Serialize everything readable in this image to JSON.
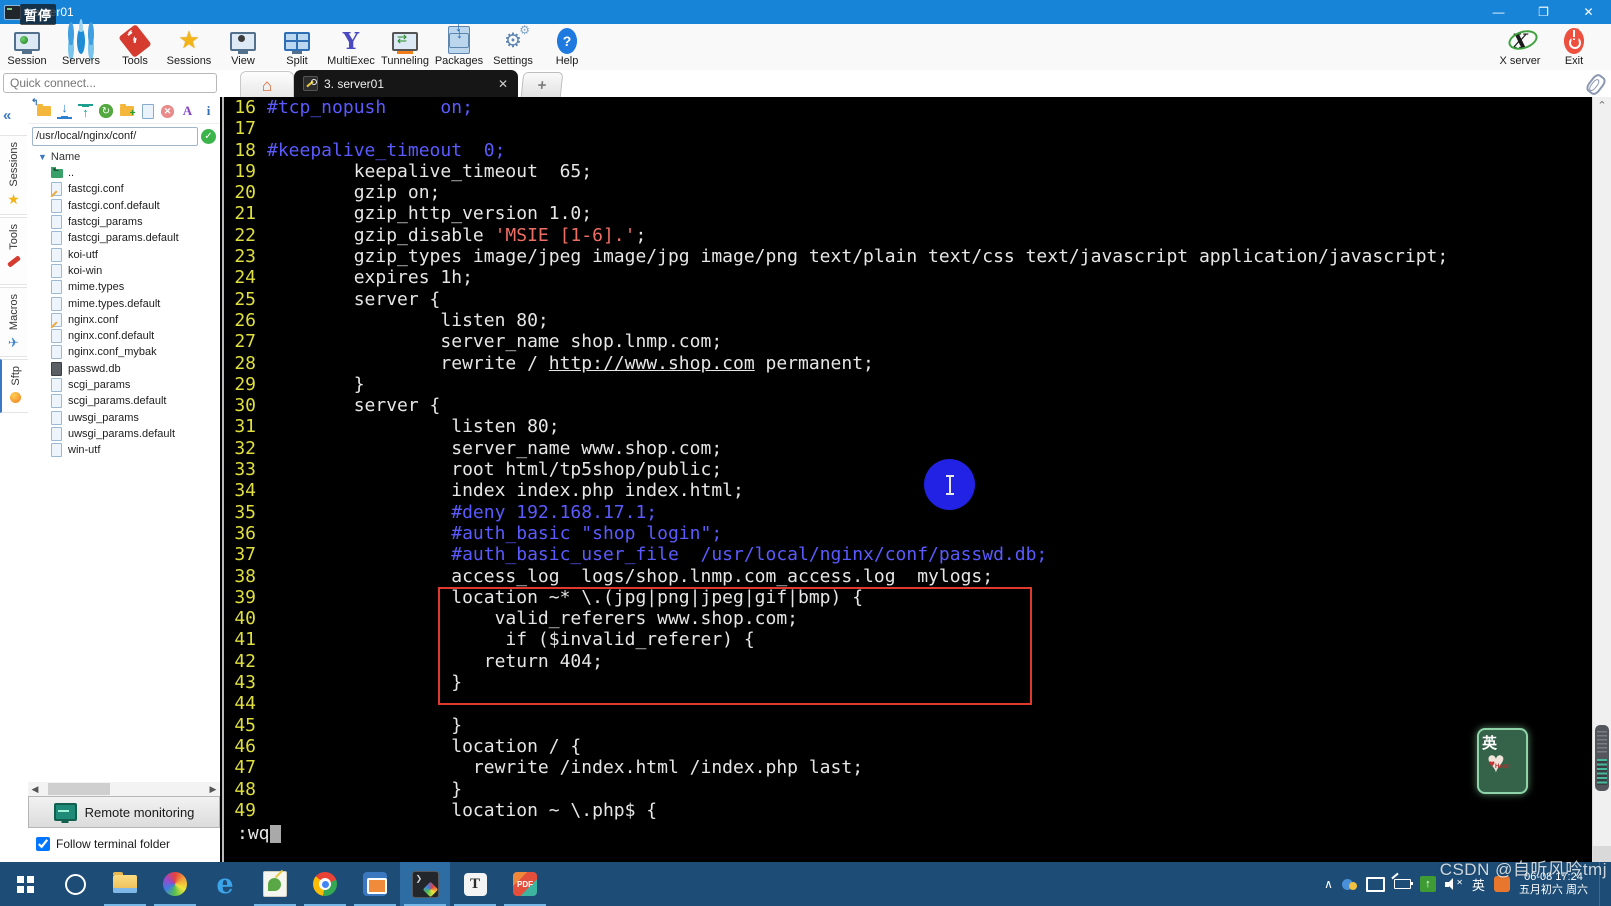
{
  "window": {
    "title": "server01",
    "recorder_overlay": "暂停",
    "controls": {
      "minimize": "—",
      "maximize": "❐",
      "close": "✕"
    }
  },
  "toolbar": {
    "items": [
      {
        "name": "session",
        "label": "Session"
      },
      {
        "name": "servers",
        "label": "Servers"
      },
      {
        "name": "tools",
        "label": "Tools"
      },
      {
        "name": "sessions",
        "label": "Sessions"
      },
      {
        "name": "view",
        "label": "View"
      },
      {
        "name": "split",
        "label": "Split"
      },
      {
        "name": "multiexec",
        "label": "MultiExec"
      },
      {
        "name": "tunneling",
        "label": "Tunneling"
      },
      {
        "name": "packages",
        "label": "Packages"
      },
      {
        "name": "settings",
        "label": "Settings"
      },
      {
        "name": "help",
        "label": "Help"
      }
    ],
    "right_items": [
      {
        "name": "xserver",
        "label": "X server"
      },
      {
        "name": "exit",
        "label": "Exit"
      }
    ]
  },
  "tabbar": {
    "quick_connect_placeholder": "Quick connect...",
    "active_tab": "3. server01",
    "close_glyph": "✕",
    "new_tab_glyph": "+"
  },
  "sidebar": {
    "tabs": [
      {
        "name": "sessions",
        "label": "Sessions",
        "icon": "star"
      },
      {
        "name": "tools",
        "label": "Tools",
        "icon": "knife"
      },
      {
        "name": "macros",
        "label": "Macros",
        "icon": "plane"
      },
      {
        "name": "sftp",
        "label": "Sftp",
        "icon": "ball",
        "active": true
      }
    ],
    "file_toolbar": [
      "parent-dir",
      "download",
      "upload",
      "refresh",
      "new-folder",
      "new-file",
      "delete",
      "rename",
      "info"
    ],
    "path": "/usr/local/nginx/conf/",
    "column_header": "Name",
    "files": [
      {
        "name": "..",
        "type": "parent"
      },
      {
        "name": "fastcgi.conf",
        "type": "edited"
      },
      {
        "name": "fastcgi.conf.default",
        "type": "file"
      },
      {
        "name": "fastcgi_params",
        "type": "file"
      },
      {
        "name": "fastcgi_params.default",
        "type": "file"
      },
      {
        "name": "koi-utf",
        "type": "file"
      },
      {
        "name": "koi-win",
        "type": "file"
      },
      {
        "name": "mime.types",
        "type": "file"
      },
      {
        "name": "mime.types.default",
        "type": "file"
      },
      {
        "name": "nginx.conf",
        "type": "edited"
      },
      {
        "name": "nginx.conf.default",
        "type": "file"
      },
      {
        "name": "nginx.conf_mybak",
        "type": "file"
      },
      {
        "name": "passwd.db",
        "type": "db"
      },
      {
        "name": "scgi_params",
        "type": "file"
      },
      {
        "name": "scgi_params.default",
        "type": "file"
      },
      {
        "name": "uwsgi_params",
        "type": "file"
      },
      {
        "name": "uwsgi_params.default",
        "type": "file"
      },
      {
        "name": "win-utf",
        "type": "file"
      }
    ],
    "remote_monitoring_label": "Remote monitoring",
    "follow_terminal_label": "Follow terminal folder",
    "follow_terminal_checked": true
  },
  "terminal": {
    "colors": {
      "background": "#000000",
      "line_number": "#dfdf3e",
      "text": "#e6e6e6",
      "comment": "#5a5aff",
      "string": "#ef6e64"
    },
    "lines": [
      {
        "n": "16",
        "s": [
          [
            "c",
            "#tcp_nopush     on;"
          ]
        ]
      },
      {
        "n": "17",
        "s": []
      },
      {
        "n": "18",
        "s": [
          [
            "c",
            "#keepalive_timeout  0;"
          ]
        ]
      },
      {
        "n": "19",
        "s": [
          [
            "t",
            "        keepalive_timeout  65;"
          ]
        ]
      },
      {
        "n": "20",
        "s": [
          [
            "t",
            "        gzip on;"
          ]
        ]
      },
      {
        "n": "21",
        "s": [
          [
            "t",
            "        gzip_http_version 1.0;"
          ]
        ]
      },
      {
        "n": "22",
        "s": [
          [
            "t",
            "        gzip_disable "
          ],
          [
            "s",
            "'MSIE [1-6].'"
          ],
          [
            "t",
            ";"
          ]
        ]
      },
      {
        "n": "23",
        "s": [
          [
            "t",
            "        gzip_types image/jpeg image/jpg image/png text/plain text/css text/javascript application/javascript;"
          ]
        ]
      },
      {
        "n": "24",
        "s": [
          [
            "t",
            "        expires 1h;"
          ]
        ]
      },
      {
        "n": "25",
        "s": [
          [
            "t",
            "        server {"
          ]
        ]
      },
      {
        "n": "26",
        "s": [
          [
            "t",
            "                listen 80;"
          ]
        ]
      },
      {
        "n": "27",
        "s": [
          [
            "t",
            "                server_name shop.lnmp.com;"
          ]
        ]
      },
      {
        "n": "28",
        "s": [
          [
            "t",
            "                rewrite / "
          ],
          [
            "u",
            "http://www.shop.com"
          ],
          [
            "t",
            " permanent;"
          ]
        ]
      },
      {
        "n": "29",
        "s": [
          [
            "t",
            "        }"
          ]
        ]
      },
      {
        "n": "30",
        "s": [
          [
            "t",
            "        server {"
          ]
        ]
      },
      {
        "n": "31",
        "s": [
          [
            "t",
            "                 listen 80;"
          ]
        ]
      },
      {
        "n": "32",
        "s": [
          [
            "t",
            "                 server_name www.shop.com;"
          ]
        ]
      },
      {
        "n": "33",
        "s": [
          [
            "t",
            "                 root html/tp5shop/public;"
          ]
        ]
      },
      {
        "n": "34",
        "s": [
          [
            "t",
            "                 index index.php index.html;"
          ]
        ]
      },
      {
        "n": "35",
        "s": [
          [
            "c",
            "                 #deny 192.168.17.1;"
          ]
        ]
      },
      {
        "n": "36",
        "s": [
          [
            "c",
            "                 #auth_basic \"shop login\";"
          ]
        ]
      },
      {
        "n": "37",
        "s": [
          [
            "c",
            "                 #auth_basic_user_file  /usr/local/nginx/conf/passwd.db;"
          ]
        ]
      },
      {
        "n": "38",
        "s": [
          [
            "t",
            "                 access_log  logs/shop.lnmp.com_access.log  mylogs;"
          ]
        ]
      },
      {
        "n": "39",
        "s": [
          [
            "t",
            "                 location ~* \\.(jpg|png|jpeg|gif|bmp) {"
          ]
        ]
      },
      {
        "n": "40",
        "s": [
          [
            "t",
            "                     valid_referers www.shop.com;"
          ]
        ]
      },
      {
        "n": "41",
        "s": [
          [
            "t",
            "                      if ($invalid_referer) {"
          ]
        ]
      },
      {
        "n": "42",
        "s": [
          [
            "t",
            "                    return 404;"
          ]
        ]
      },
      {
        "n": "43",
        "s": [
          [
            "t",
            "                 }"
          ]
        ]
      },
      {
        "n": "44",
        "s": []
      },
      {
        "n": "45",
        "s": [
          [
            "t",
            "                 }"
          ]
        ]
      },
      {
        "n": "46",
        "s": [
          [
            "t",
            "                 location / {"
          ]
        ]
      },
      {
        "n": "47",
        "s": [
          [
            "t",
            "                   rewrite /index.html /index.php last;"
          ]
        ]
      },
      {
        "n": "48",
        "s": [
          [
            "t",
            "                 }"
          ]
        ]
      },
      {
        "n": "49",
        "s": [
          [
            "t",
            "                 location ~ \\.php$ {"
          ]
        ]
      }
    ],
    "status_command": ":wq"
  },
  "annotations": {
    "highlight_box_color": "#e0392d",
    "pointer_dot_color": "#2222e4"
  },
  "taskbar": {
    "apps": [
      "start",
      "cortana",
      "explorer",
      "browser-sphere",
      "edge",
      "image-viewer",
      "chrome",
      "vmware",
      "mobaxterm",
      "typora",
      "pdf-reader"
    ],
    "active_app": "mobaxterm",
    "running_apps": [
      "explorer",
      "browser-sphere",
      "image-viewer",
      "chrome",
      "vmware",
      "mobaxterm",
      "typora",
      "pdf-reader"
    ],
    "tray_icons": [
      "chevron-up",
      "cloud",
      "display",
      "battery",
      "upload-green",
      "volume-muted"
    ],
    "ime_indicator": "英",
    "time": "06-08 17:24",
    "date": "五月初六 周六"
  },
  "watermark": "CSDN @自听风吟tmj",
  "ime_badge": {
    "char": "英",
    "heart_label": "Heart"
  }
}
